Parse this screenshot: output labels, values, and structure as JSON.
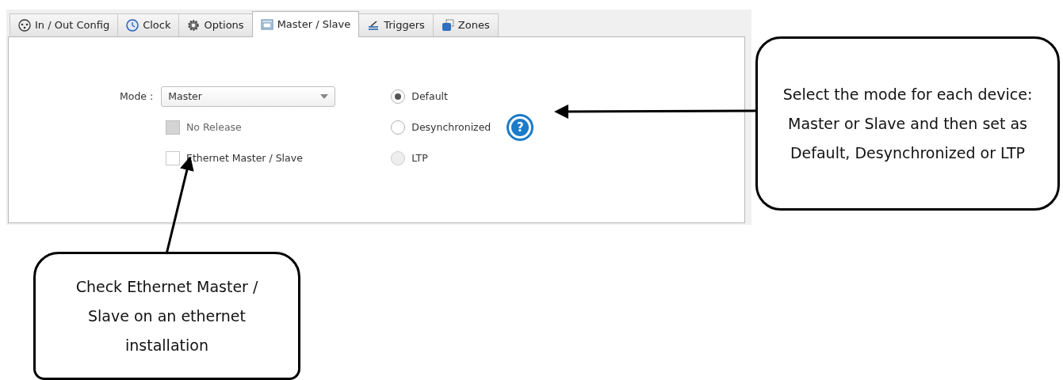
{
  "tabs": [
    {
      "label": "In / Out Config",
      "kind": "connector",
      "selected": false
    },
    {
      "label": "Clock",
      "kind": "clock",
      "selected": false
    },
    {
      "label": "Options",
      "kind": "gear",
      "selected": false
    },
    {
      "label": "Master / Slave",
      "kind": "ltp",
      "selected": true
    },
    {
      "label": "Triggers",
      "kind": "trigger",
      "selected": false
    },
    {
      "label": "Zones",
      "kind": "zone",
      "selected": false
    }
  ],
  "mode": {
    "label": "Mode :",
    "value": "Master"
  },
  "checkboxes": [
    {
      "label": "No Release",
      "checked": false,
      "disabled": true
    },
    {
      "label": "Ethernet Master / Slave",
      "checked": false,
      "disabled": false
    }
  ],
  "radios": [
    {
      "label": "Default",
      "selected": true,
      "disabled": false
    },
    {
      "label": "Desynchronized",
      "selected": false,
      "disabled": false
    },
    {
      "label": "LTP",
      "selected": false,
      "disabled": true
    }
  ],
  "help": {
    "symbol": "?"
  },
  "callouts": [
    {
      "text": "Select the mode for each device: Master or Slave and then set as Default, Desynchronized or LTP"
    },
    {
      "text": "Check Ethernet Master / Slave on an ethernet installation"
    }
  ]
}
